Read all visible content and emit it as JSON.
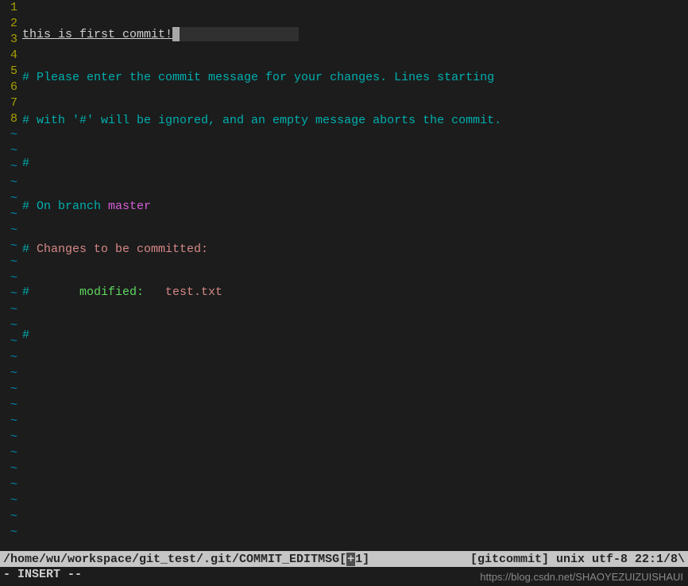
{
  "editor": {
    "lines": {
      "1": {
        "num": "1"
      },
      "2": {
        "num": "2"
      },
      "3": {
        "num": "3"
      },
      "4": {
        "num": "4"
      },
      "5": {
        "num": "5"
      },
      "6": {
        "num": "6"
      },
      "7": {
        "num": "7"
      },
      "8": {
        "num": "8"
      }
    },
    "tilde": "~",
    "line1_text": "this is first commit!",
    "line2_text": "# Please enter the commit message for your changes. Lines starting",
    "line3_text": "# with '#' will be ignored, and an empty message aborts the commit.",
    "line4_text": "#",
    "line5_prefix": "# On branch ",
    "line5_branch": "master",
    "line6_prefix": "# ",
    "line6_text": "Changes to be committed:",
    "line7_prefix": "#       ",
    "line7_label": "modified:   ",
    "line7_file": "test.txt",
    "line8_text": "#"
  },
  "status": {
    "path_left": "/home/wu/workspace/git_test/.git/COMMIT_EDITMSG[",
    "plus": "+",
    "path_mid": "1]",
    "right": "[gitcommit] unix utf-8 22:1/8\\"
  },
  "mode": "- INSERT --",
  "watermark": "https://blog.csdn.net/SHAOYEZUIZUISHAUI"
}
